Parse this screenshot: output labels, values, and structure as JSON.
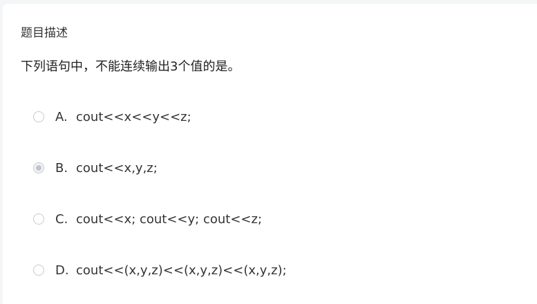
{
  "section": {
    "title": "题目描述"
  },
  "question": {
    "text": "下列语句中，不能连续输出3个值的是。"
  },
  "options": [
    {
      "letter": "A.",
      "text": "cout<<x<<y<<z;",
      "selected": false
    },
    {
      "letter": "B.",
      "text": "cout<<x,y,z;",
      "selected": true
    },
    {
      "letter": "C.",
      "text": "cout<<x; cout<<y; cout<<z;",
      "selected": false
    },
    {
      "letter": "D.",
      "text": "cout<<(x,y,z)<<(x,y,z)<<(x,y,z);",
      "selected": false
    }
  ]
}
